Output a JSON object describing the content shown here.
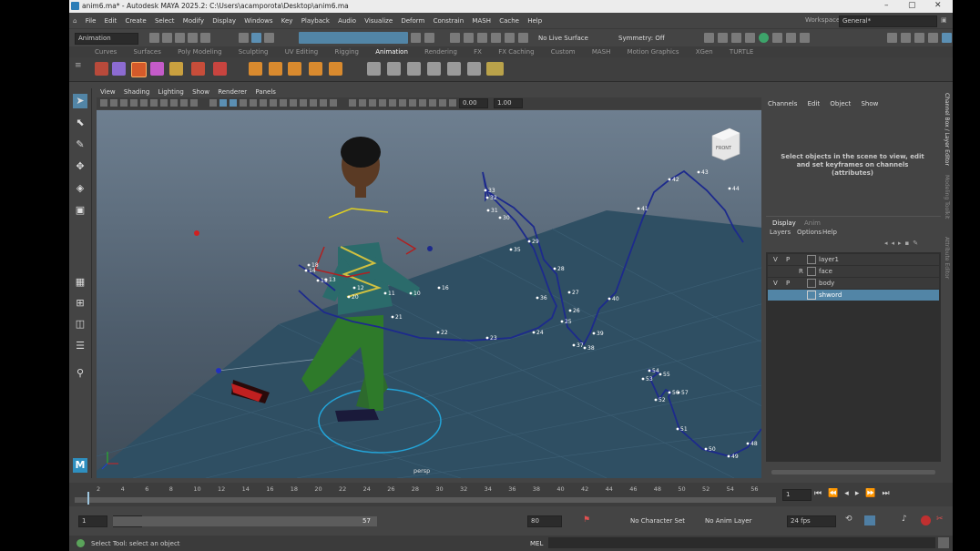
{
  "window": {
    "title": "anim6.ma* - Autodesk MAYA 2025.2: C:\\Users\\acamporota\\Desktop\\anim6.ma",
    "controls": [
      "–",
      "▢",
      "✕"
    ]
  },
  "menubar": [
    "File",
    "Edit",
    "Create",
    "Select",
    "Modify",
    "Display",
    "Windows",
    "Key",
    "Playback",
    "Audio",
    "Visualize",
    "Deform",
    "Constrain",
    "MASH",
    "Cache",
    "Help"
  ],
  "workspace": {
    "label": "Workspace:",
    "value": "General*"
  },
  "statusline": {
    "menuset": "Animation",
    "live_surface": "No Live Surface",
    "symmetry": "Symmetry: Off"
  },
  "shelf_tabs": [
    "Curves",
    "Surfaces",
    "Poly Modeling",
    "Sculpting",
    "UV Editing",
    "Rigging",
    "Animation",
    "Rendering",
    "FX",
    "FX Caching",
    "Custom",
    "MASH",
    "Motion Graphics",
    "XGen",
    "TURTLE"
  ],
  "shelf_active": "Animation",
  "viewport": {
    "menu": [
      "View",
      "Shading",
      "Lighting",
      "Show",
      "Renderer",
      "Panels"
    ],
    "field1": "0.00",
    "field2": "1.00",
    "camera_label": "persp",
    "viewcube_label": "FRONT",
    "motion_trail_labels": [
      {
        "t": "33"
      },
      {
        "t": "32"
      },
      {
        "t": "31"
      },
      {
        "t": "30"
      },
      {
        "t": "35"
      },
      {
        "t": "29"
      },
      {
        "t": "28"
      },
      {
        "t": "27"
      },
      {
        "t": "26"
      },
      {
        "t": "36"
      },
      {
        "t": "25"
      },
      {
        "t": "24"
      },
      {
        "t": "23"
      },
      {
        "t": "22"
      },
      {
        "t": "21"
      },
      {
        "t": "20"
      },
      {
        "t": "19"
      },
      {
        "t": "18"
      },
      {
        "t": "14"
      },
      {
        "t": "13"
      },
      {
        "t": "12"
      },
      {
        "t": "11"
      },
      {
        "t": "10"
      },
      {
        "t": "16"
      },
      {
        "t": "37"
      },
      {
        "t": "38"
      },
      {
        "t": "39"
      },
      {
        "t": "40"
      },
      {
        "t": "41"
      },
      {
        "t": "42"
      },
      {
        "t": "43"
      },
      {
        "t": "44"
      },
      {
        "t": "54"
      },
      {
        "t": "55"
      },
      {
        "t": "53"
      },
      {
        "t": "52"
      },
      {
        "t": "56"
      },
      {
        "t": "57"
      },
      {
        "t": "51"
      },
      {
        "t": "50"
      },
      {
        "t": "49"
      },
      {
        "t": "48"
      }
    ]
  },
  "channelbox": {
    "menu": [
      "Channels",
      "Edit",
      "Object",
      "Show"
    ],
    "message": "Select objects in the scene to view, edit and set keyframes on channels (attributes)"
  },
  "layer_editor": {
    "tabs": [
      "Display",
      "Anim"
    ],
    "menu": [
      "Layers",
      "Options",
      "Help"
    ],
    "layers": [
      {
        "v": "V",
        "p": "P",
        "name": "layer1",
        "selected": false
      },
      {
        "v": "",
        "p": "R",
        "name": "face",
        "selected": false
      },
      {
        "v": "V",
        "p": "P",
        "name": "body",
        "selected": false
      },
      {
        "v": "",
        "p": "",
        "name": "shword",
        "selected": true
      }
    ]
  },
  "side_tabs": [
    "Channel Box / Layer Editor",
    "Modeling Toolkit",
    "Attribute Editor"
  ],
  "timeline": {
    "ticks": [
      "2",
      "4",
      "6",
      "8",
      "10",
      "12",
      "14",
      "16",
      "18",
      "20",
      "22",
      "24",
      "26",
      "28",
      "30",
      "32",
      "34",
      "36",
      "38",
      "40",
      "42",
      "44",
      "46",
      "48",
      "50",
      "52",
      "54",
      "56"
    ],
    "current_frame": "1"
  },
  "range": {
    "start": "1",
    "inner_start": "1",
    "inner_end": "57",
    "end": "80",
    "character_set": "No Character Set",
    "anim_layer": "No Anim Layer",
    "fps": "24 fps"
  },
  "helpline": {
    "message": "Select Tool: select an object",
    "mel_label": "MEL"
  },
  "colors": {
    "accent": "#5285a6",
    "trail": "#1d2a8c",
    "ground": "#2f4f63"
  }
}
